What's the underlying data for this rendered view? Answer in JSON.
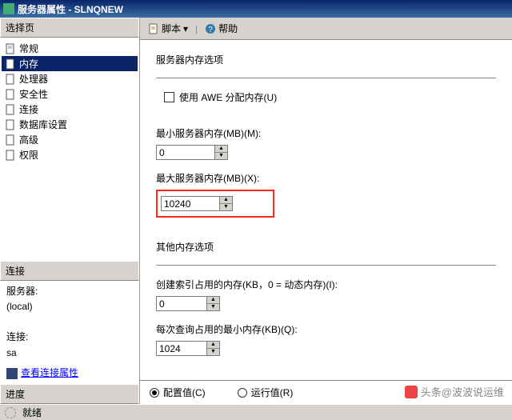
{
  "window": {
    "title": "服务器属性 - SLNQNEW"
  },
  "toolbar": {
    "script": "脚本",
    "help": "帮助"
  },
  "sidebar": {
    "select_header": "选择页",
    "items": [
      {
        "label": "常规"
      },
      {
        "label": "内存"
      },
      {
        "label": "处理器"
      },
      {
        "label": "安全性"
      },
      {
        "label": "连接"
      },
      {
        "label": "数据库设置"
      },
      {
        "label": "高级"
      },
      {
        "label": "权限"
      }
    ],
    "conn_header": "连接",
    "server_label": "服务器:",
    "server_value": "(local)",
    "connection_label": "连接:",
    "connection_value": "sa",
    "view_props": "查看连接属性",
    "progress_header": "进度",
    "status": "就绪"
  },
  "content": {
    "section1_title": "服务器内存选项",
    "awe_label": "使用 AWE 分配内存(U)",
    "min_mem_label": "最小服务器内存(MB)(M):",
    "min_mem_value": "0",
    "max_mem_label": "最大服务器内存(MB)(X):",
    "max_mem_value": "10240",
    "section2_title": "其他内存选项",
    "index_mem_label": "创建索引占用的内存(KB，0 = 动态内存)(I):",
    "index_mem_value": "0",
    "query_mem_label": "每次查询占用的最小内存(KB)(Q):",
    "query_mem_value": "1024"
  },
  "footer": {
    "configured": "配置值(C)",
    "running": "运行值(R)"
  },
  "watermark": {
    "text": "头条@波波说运维"
  }
}
